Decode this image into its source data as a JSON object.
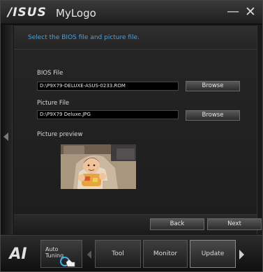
{
  "titlebar": {
    "brand": "/ISUS",
    "title": "MyLogo",
    "minimize_glyph": "—",
    "close_glyph": "✕"
  },
  "instruction": "Select the BIOS file and picture file.",
  "bios_file": {
    "label": "BIOS File",
    "value": "D:\\P9X79-DELUXE-ASUS-0233.ROM",
    "browse_label": "Browse"
  },
  "picture_file": {
    "label": "Picture File",
    "value": "D:\\P9X79 Deluxe.JPG",
    "browse_label": "Browse"
  },
  "preview": {
    "label": "Picture preview"
  },
  "actions": {
    "back": "Back",
    "next": "Next"
  },
  "bottom_nav": {
    "logo": "AI",
    "auto_tuning_line1": "Auto",
    "auto_tuning_line2": "Tuning",
    "tabs": [
      "Tool",
      "Monitor",
      "Update"
    ],
    "active_tab": "Update"
  },
  "icons": {
    "left_rail": "chevron-left-icon",
    "nav_left": "chevron-left-icon",
    "nav_right": "chevron-right-icon",
    "auto_tuning": "pointer-hand-icon"
  },
  "colors": {
    "accent": "#3fa6ea",
    "background": "#1b1b1b"
  }
}
